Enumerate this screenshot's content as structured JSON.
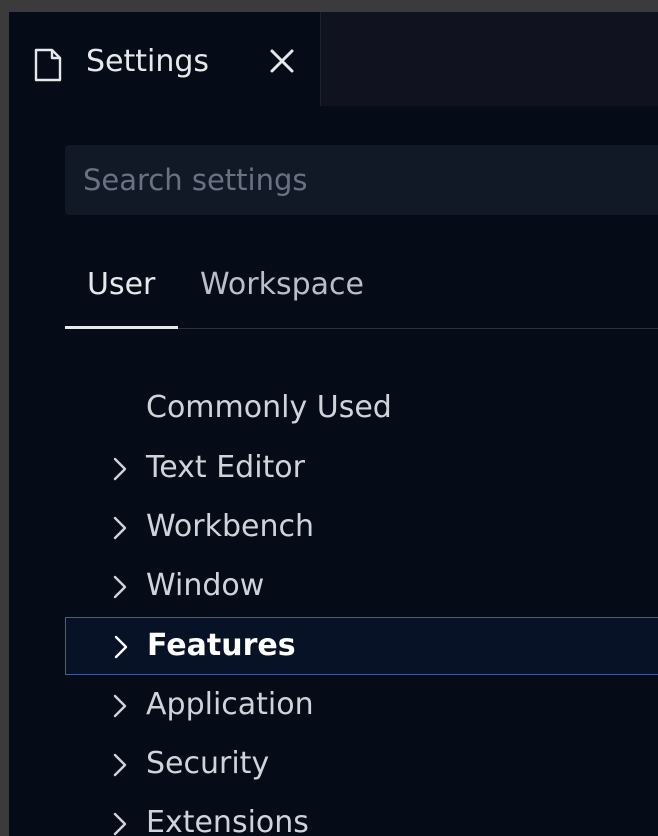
{
  "editor": {
    "tab": {
      "title": "Settings",
      "icon": "file-icon",
      "close_icon": "close-icon"
    }
  },
  "search": {
    "placeholder": "Search settings",
    "value": ""
  },
  "scope_tabs": {
    "user": "User",
    "workspace": "Workspace",
    "active": "User"
  },
  "toc": {
    "items": [
      {
        "label": "Commonly Used",
        "expandable": false,
        "selected": false
      },
      {
        "label": "Text Editor",
        "expandable": true,
        "selected": false
      },
      {
        "label": "Workbench",
        "expandable": true,
        "selected": false
      },
      {
        "label": "Window",
        "expandable": true,
        "selected": false
      },
      {
        "label": "Features",
        "expandable": true,
        "selected": true
      },
      {
        "label": "Application",
        "expandable": true,
        "selected": false
      },
      {
        "label": "Security",
        "expandable": true,
        "selected": false
      },
      {
        "label": "Extensions",
        "expandable": true,
        "selected": false
      }
    ]
  },
  "colors": {
    "background": "#050c17",
    "selection_border": "#3f5d95",
    "text": "#cfd3da"
  }
}
